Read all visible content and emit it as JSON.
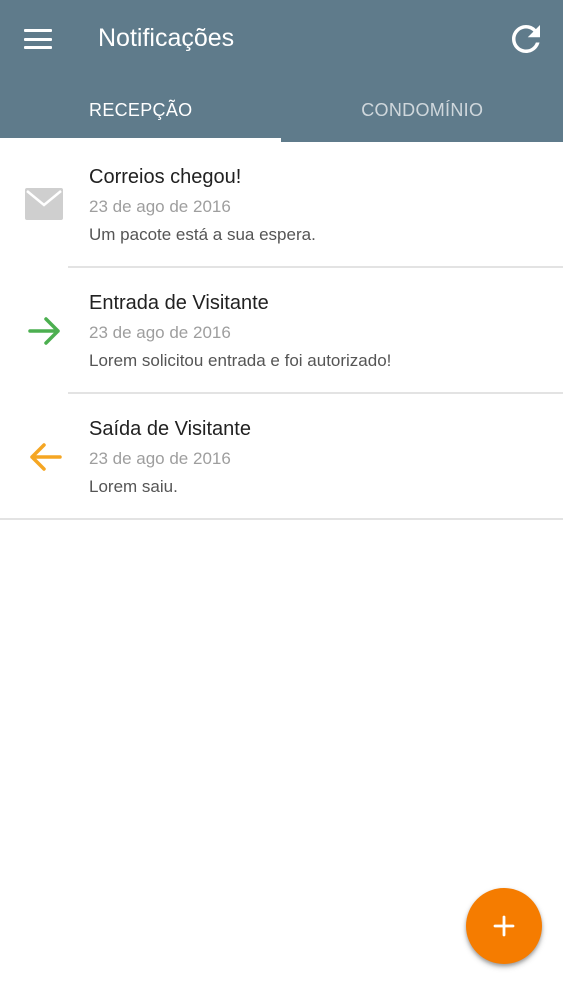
{
  "header": {
    "title": "Notificações",
    "menu_icon": "menu-icon",
    "refresh_icon": "refresh-icon",
    "background": "#5f7b8b"
  },
  "tabs": [
    {
      "label": "RECEPÇÃO",
      "active": true
    },
    {
      "label": "CONDOMÍNIO",
      "active": false
    }
  ],
  "notifications": [
    {
      "icon": "mail-icon",
      "icon_color": "#cfcfcf",
      "title": "Correios chegou!",
      "date": "23 de ago de 2016",
      "body": "Um pacote está a sua espera."
    },
    {
      "icon": "arrow-right-icon",
      "icon_color": "#4caf50",
      "title": "Entrada de Visitante",
      "date": "23 de ago de 2016",
      "body": "Lorem solicitou entrada e foi autorizado!"
    },
    {
      "icon": "arrow-left-icon",
      "icon_color": "#f5a623",
      "title": "Saída de Visitante",
      "date": "23 de ago de 2016",
      "body": "Lorem saiu."
    }
  ],
  "fab": {
    "icon": "plus-icon",
    "color": "#f57c00"
  }
}
